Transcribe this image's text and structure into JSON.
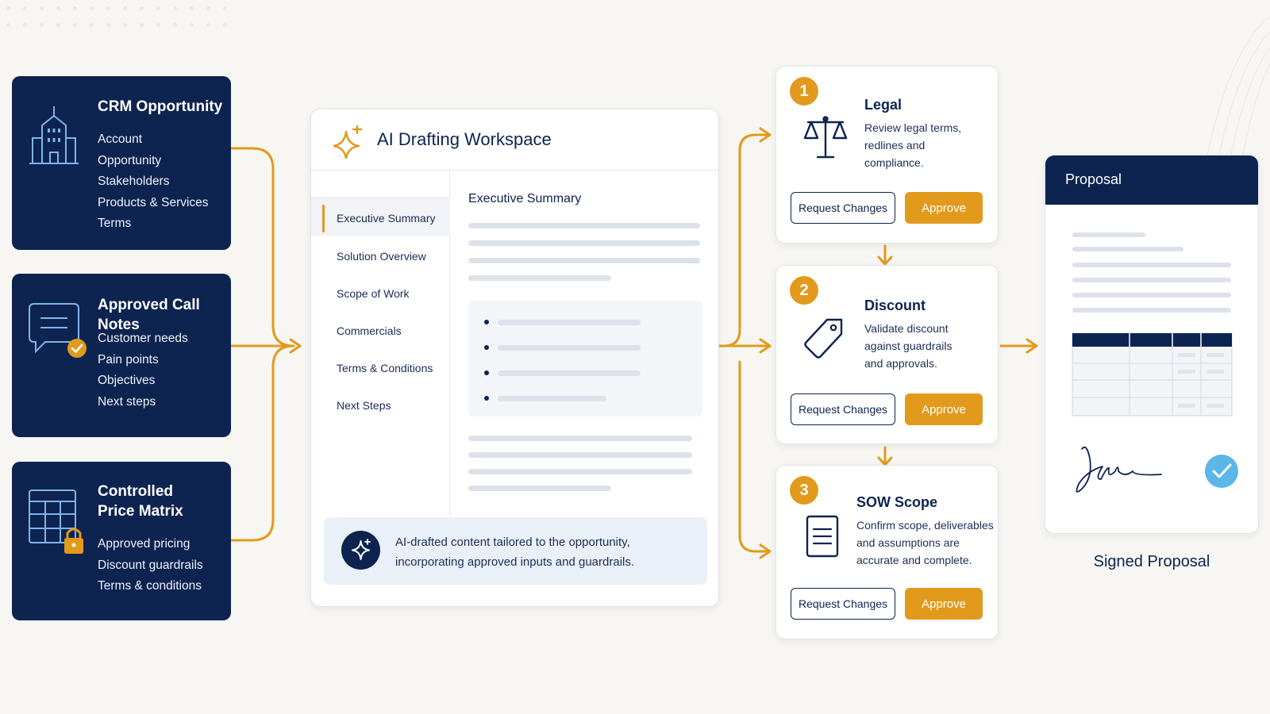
{
  "colors": {
    "navy": "#0d2350",
    "accent": "#e29a1d",
    "check": "#5ab7e6"
  },
  "sources": [
    {
      "title": "CRM Opportunity",
      "icon": "building-icon",
      "items": [
        "Account",
        "Opportunity",
        "Stakeholders",
        "Products & Services",
        "Terms"
      ]
    },
    {
      "title": "Approved Call Notes",
      "icon": "chat-check-icon",
      "items": [
        "Customer needs",
        "Pain points",
        "Objectives",
        "Next steps"
      ]
    },
    {
      "title_lines": [
        "Controlled",
        "Price Matrix"
      ],
      "icon": "locked-grid-icon",
      "items": [
        "Approved pricing",
        "Discount guardrails",
        "Terms & conditions"
      ]
    }
  ],
  "workspace": {
    "title": "AI Drafting Workspace",
    "icon": "sparkle-icon",
    "nav": [
      "Executive Summary",
      "Solution Overview",
      "Scope of Work",
      "Commercials",
      "Terms & Conditions",
      "Next Steps"
    ],
    "active_nav": "Executive Summary",
    "section_title": "Executive Summary",
    "footer_text_lines": [
      "AI-drafted content tailored to the opportunity,",
      "incorporating approved inputs and guardrails."
    ]
  },
  "reviews": [
    {
      "step": "1",
      "title": "Legal",
      "icon": "scales-icon",
      "desc_lines": [
        "Review legal terms,",
        "redlines and",
        "compliance."
      ],
      "reject_label": "Request Changes",
      "approve_label": "Approve"
    },
    {
      "step": "2",
      "title": "Discount",
      "icon": "tag-icon",
      "desc_lines": [
        "Validate discount",
        "against guardrails",
        "and approvals."
      ],
      "reject_label": "Request Changes",
      "approve_label": "Approve"
    },
    {
      "step": "3",
      "title": "SOW Scope",
      "icon": "document-icon",
      "desc_lines": [
        "Confirm scope, deliverables",
        "and assumptions are",
        "accurate and complete."
      ],
      "reject_label": "Request Changes",
      "approve_label": "Approve"
    }
  ],
  "proposal": {
    "title": "Proposal",
    "signed_label": "Signed Proposal"
  }
}
